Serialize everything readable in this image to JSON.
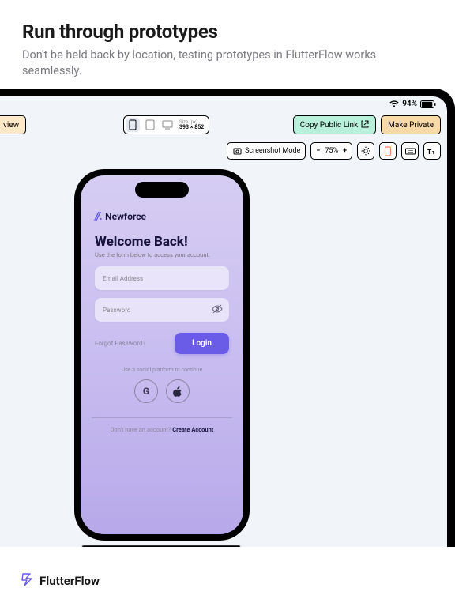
{
  "header": {
    "title": "Run through prototypes",
    "subtitle": "Don't be held back by location, testing prototypes in FlutterFlow works seamlessly."
  },
  "status": {
    "battery": "94%"
  },
  "toolbar": {
    "view_label": "view",
    "size_label": "Size (px)",
    "size_value": "393 × 852",
    "copy_label": "Copy Public Link",
    "private_label": "Make Private"
  },
  "toolbar2": {
    "screenshot_label": "Screenshot Mode",
    "zoom_value": "75%"
  },
  "app": {
    "brand": "Newforce",
    "welcome_title": "Welcome Back!",
    "welcome_sub": "Use the form below to access your account.",
    "email_placeholder": "Email Address",
    "password_placeholder": "Password",
    "forgot": "Forgot Password?",
    "login": "Login",
    "social_label": "Use a social platform to continue",
    "google": "G",
    "no_account": "Don't have an account? ",
    "create": "Create Account"
  },
  "footer": {
    "brand": "FlutterFlow"
  }
}
